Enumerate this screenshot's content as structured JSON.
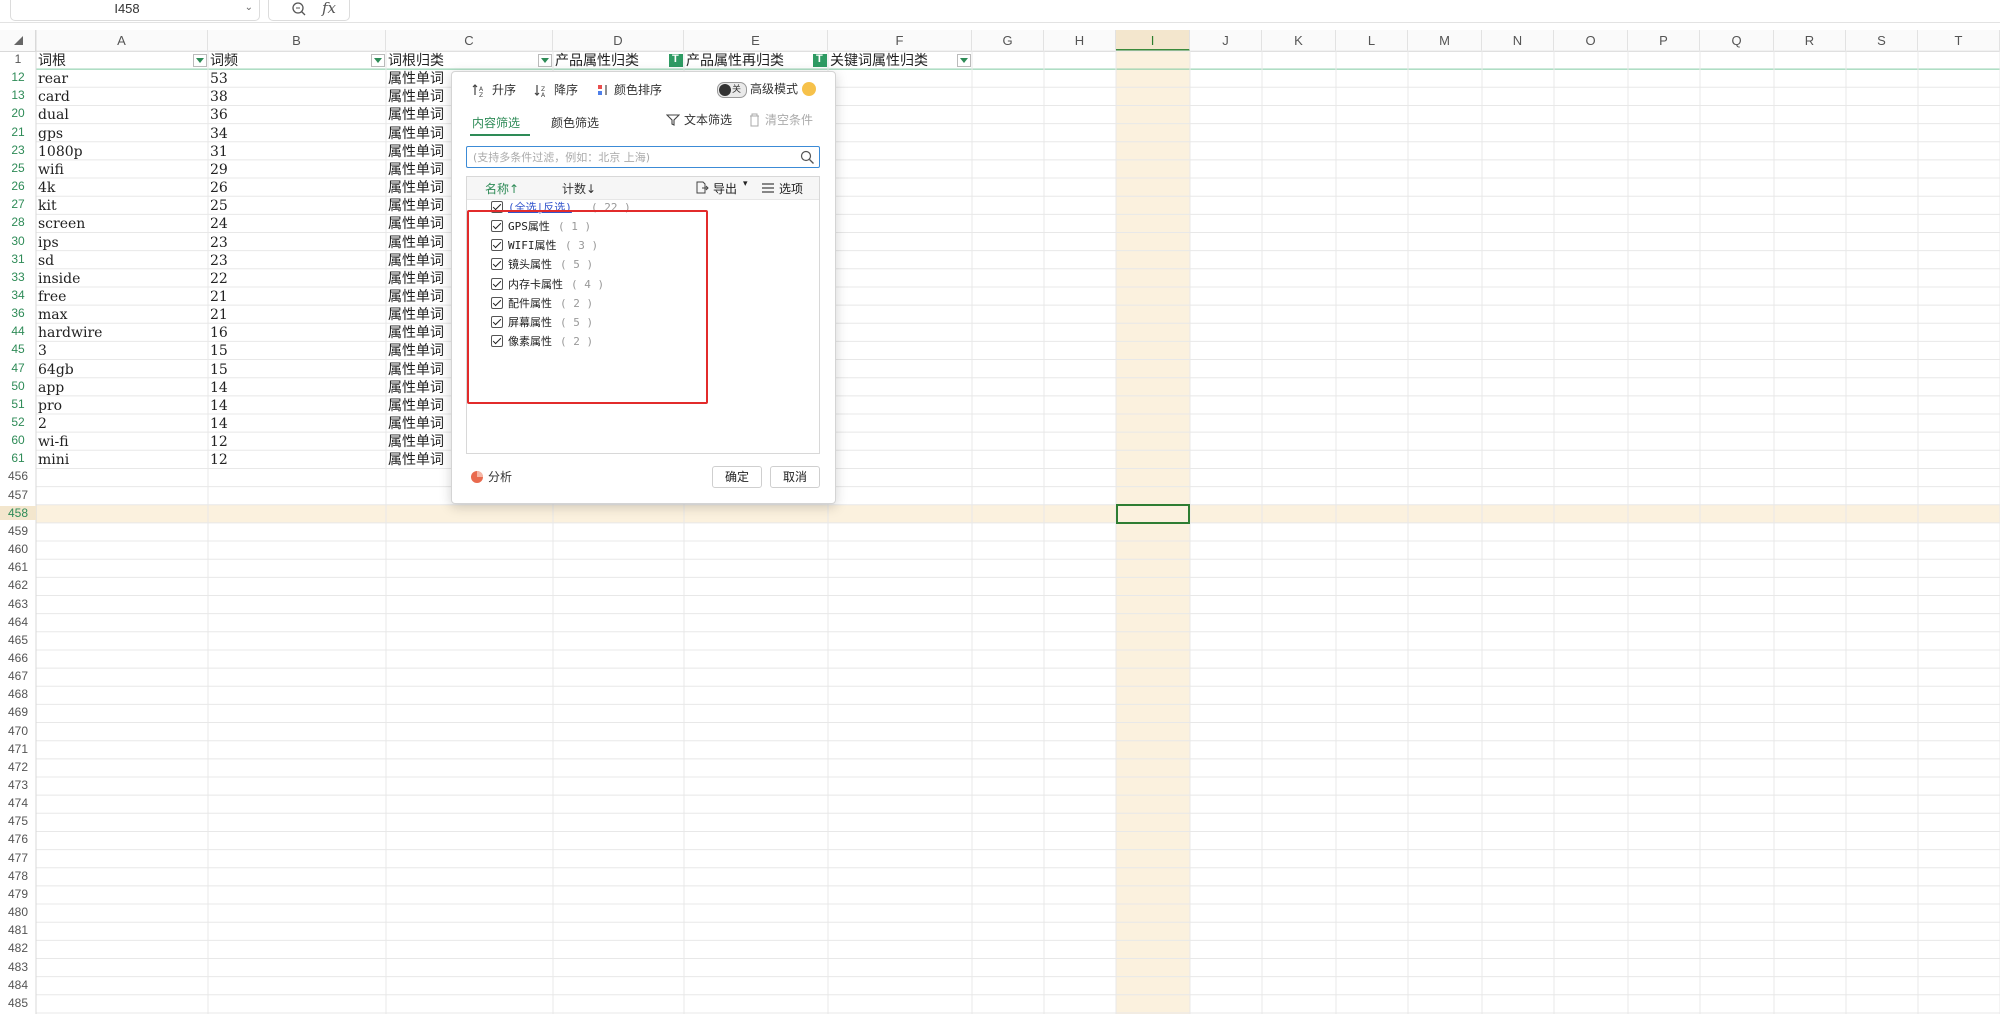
{
  "formula_bar": {
    "name_box": "I458",
    "fx": "fx",
    "formula": ""
  },
  "columns": [
    "A",
    "B",
    "C",
    "D",
    "E",
    "F",
    "G",
    "H",
    "I",
    "J",
    "K",
    "L",
    "M",
    "N",
    "O",
    "P",
    "Q",
    "R",
    "S",
    "T"
  ],
  "active_column": "I",
  "header_row": {
    "row_num": "1",
    "cells": [
      "词根",
      "词频",
      "词根归类",
      "产品属性归类",
      "产品属性再归类",
      "关键词属性归类"
    ]
  },
  "data_rows": [
    {
      "row": "12",
      "a": "rear",
      "b": "53",
      "c": "属性单词"
    },
    {
      "row": "13",
      "a": "card",
      "b": "38",
      "c": "属性单词"
    },
    {
      "row": "20",
      "a": "dual",
      "b": "36",
      "c": "属性单词"
    },
    {
      "row": "21",
      "a": "gps",
      "b": "34",
      "c": "属性单词"
    },
    {
      "row": "23",
      "a": "1080p",
      "b": "31",
      "c": "属性单词"
    },
    {
      "row": "25",
      "a": "wifi",
      "b": "29",
      "c": "属性单词"
    },
    {
      "row": "26",
      "a": "4k",
      "b": "26",
      "c": "属性单词"
    },
    {
      "row": "27",
      "a": "kit",
      "b": "25",
      "c": "属性单词"
    },
    {
      "row": "28",
      "a": "screen",
      "b": "24",
      "c": "属性单词"
    },
    {
      "row": "30",
      "a": "ips",
      "b": "23",
      "c": "属性单词"
    },
    {
      "row": "31",
      "a": "sd",
      "b": "23",
      "c": "属性单词"
    },
    {
      "row": "33",
      "a": "inside",
      "b": "22",
      "c": "属性单词"
    },
    {
      "row": "34",
      "a": "free",
      "b": "21",
      "c": "属性单词"
    },
    {
      "row": "36",
      "a": "max",
      "b": "21",
      "c": "属性单词"
    },
    {
      "row": "44",
      "a": "hardwire",
      "b": "16",
      "c": "属性单词"
    },
    {
      "row": "45",
      "a": "3",
      "b": "15",
      "c": "属性单词"
    },
    {
      "row": "47",
      "a": "64gb",
      "b": "15",
      "c": "属性单词"
    },
    {
      "row": "50",
      "a": "app",
      "b": "14",
      "c": "属性单词"
    },
    {
      "row": "51",
      "a": "pro",
      "b": "14",
      "c": "属性单词"
    },
    {
      "row": "52",
      "a": "2",
      "b": "14",
      "c": "属性单词"
    },
    {
      "row": "60",
      "a": "wi-fi",
      "b": "12",
      "c": "属性单词"
    },
    {
      "row": "61",
      "a": "mini",
      "b": "12",
      "c": "属性单词"
    }
  ],
  "empty_rows": [
    "456",
    "457",
    "458",
    "459",
    "460",
    "461",
    "462",
    "463",
    "464",
    "465",
    "466",
    "467",
    "468",
    "469",
    "470",
    "471",
    "472",
    "473",
    "474",
    "475",
    "476",
    "477",
    "478",
    "479",
    "480",
    "481",
    "482",
    "483",
    "484",
    "485"
  ],
  "active_row": "458",
  "filter_dialog": {
    "sort_asc": "升序",
    "sort_desc": "降序",
    "sort_color": "颜色排序",
    "advanced_mode": "高级模式",
    "toggle_state": "关",
    "tab_content": "内容筛选",
    "tab_color": "颜色筛选",
    "text_filter": "文本筛选",
    "clear_conditions": "清空条件",
    "search_placeholder": "(支持多条件过滤，例如：北京 上海)",
    "col_name": "名称↑",
    "col_count": "计数↓",
    "export": "导出",
    "options": "选项",
    "select_all": "(全选|反选)",
    "select_all_count": "( 22 )",
    "items": [
      {
        "label": "GPS属性",
        "count": "( 1 )"
      },
      {
        "label": "WIFI属性",
        "count": "( 3 )"
      },
      {
        "label": "镜头属性",
        "count": "( 5 )"
      },
      {
        "label": "内存卡属性",
        "count": "( 4 )"
      },
      {
        "label": "配件属性",
        "count": "( 2 )"
      },
      {
        "label": "屏幕属性",
        "count": "( 5 )"
      },
      {
        "label": "像素属性",
        "count": "( 2 )"
      }
    ],
    "analyze": "分析",
    "ok": "确定",
    "cancel": "取消"
  },
  "colors": {
    "accent_green": "#2e8b57",
    "highlight_box": "#e22b2b",
    "active_col_bg": "#f3e6cd"
  }
}
